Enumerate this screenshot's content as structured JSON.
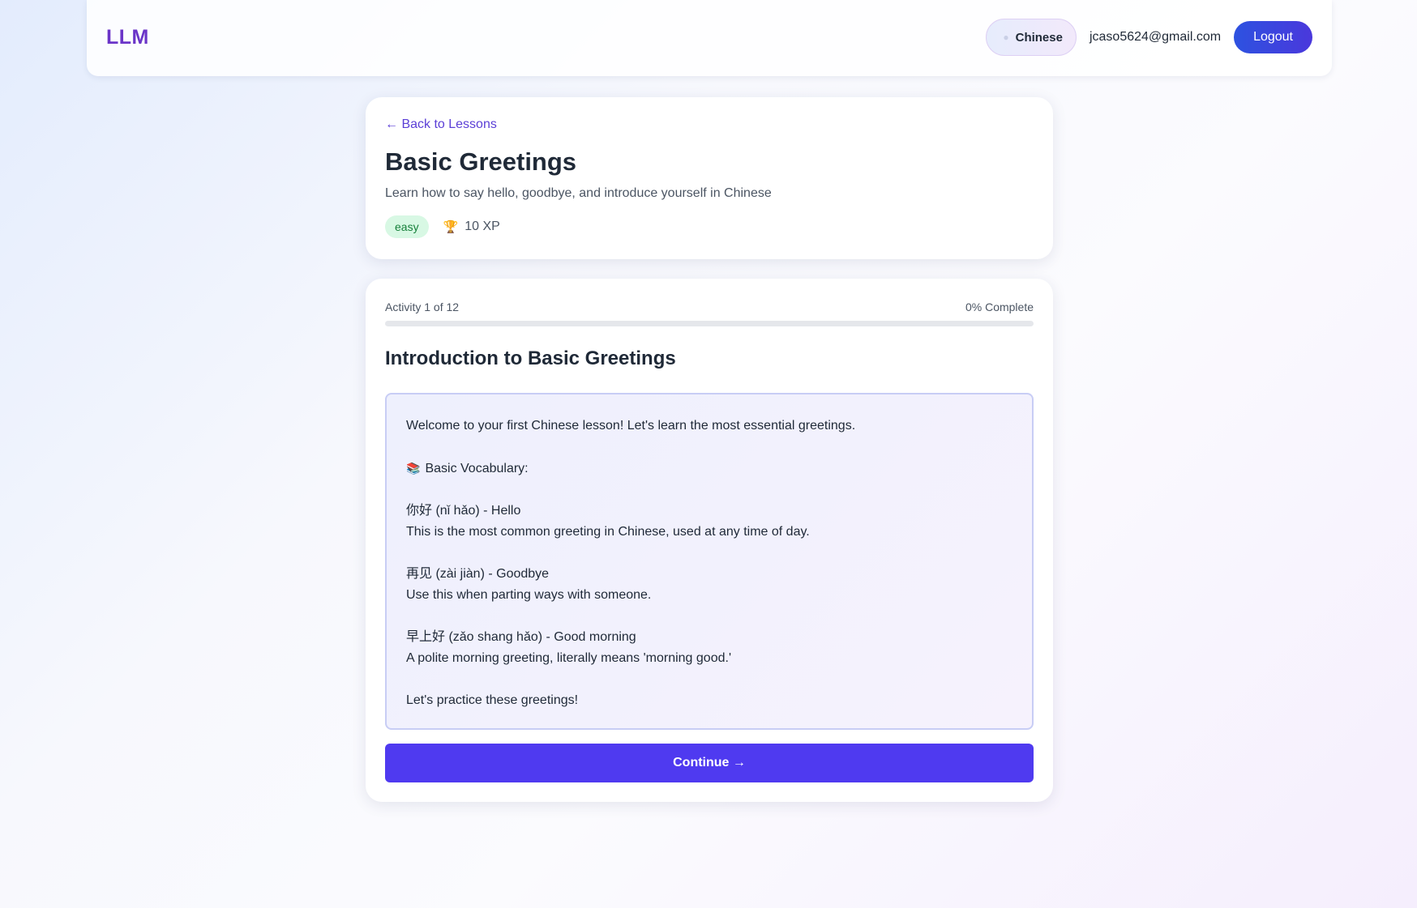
{
  "navbar": {
    "logo": "LLM",
    "language": "Chinese",
    "user_email": "jcaso5624@gmail.com",
    "logout_label": "Logout"
  },
  "lesson": {
    "back_label": "← Back to Lessons",
    "title": "Basic Greetings",
    "description": "Learn how to say hello, goodbye, and introduce yourself in Chinese",
    "difficulty": "easy",
    "xp": "10 XP",
    "xp_icon": "trophy-icon"
  },
  "activity": {
    "progress_label": "Activity 1 of 12",
    "progress_pct_label": "0% Complete",
    "progress_value": 0,
    "title": "Introduction to Basic Greetings",
    "content": {
      "intro": "Welcome to your first Chinese lesson! Let's learn the most essential greetings.",
      "vocab_icon": "books-icon",
      "vocab_heading": "Basic Vocabulary:",
      "items": [
        {
          "term": "你好 (nǐ hǎo) - Hello",
          "note": "This is the most common greeting in Chinese, used at any time of day."
        },
        {
          "term": "再见 (zài jiàn) - Goodbye",
          "note": "Use this when parting ways with someone."
        },
        {
          "term": "早上好 (zǎo shang hǎo) - Good morning",
          "note": "A polite morning greeting, literally means 'morning good.'"
        }
      ],
      "outro": "Let's practice these greetings!"
    },
    "continue_label": "Continue →"
  },
  "colors": {
    "brand": "#6b35c8",
    "accent": "#4f3af0",
    "easy_bg": "#d8f8e4",
    "easy_text": "#16803a"
  }
}
